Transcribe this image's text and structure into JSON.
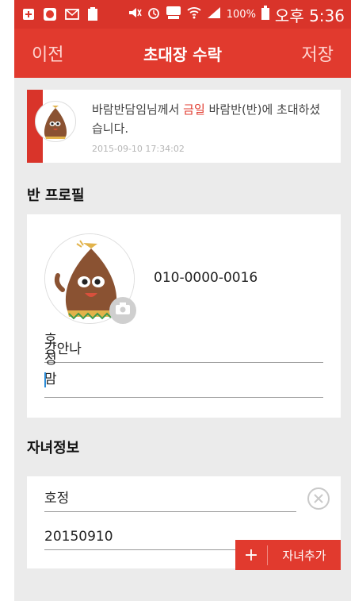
{
  "status_bar": {
    "battery": "100%",
    "time": "오후 5:36"
  },
  "appbar": {
    "back_label": "이전",
    "title": "초대장 수락",
    "save_label": "저장"
  },
  "invite": {
    "message_prefix": "바람반담임님께서 ",
    "highlight": "금일",
    "message_suffix": " 바람반(반)에 초대하셨습니다.",
    "timestamp": "2015-09-10 17:34:02"
  },
  "profile_section": {
    "title": "반 프로필",
    "phone": "010-0000-0016",
    "name_value": "강안나",
    "nickname_value": "호정맘"
  },
  "children_section": {
    "title": "자녀정보",
    "child_name_value": "호정",
    "child_birth_value": "20150910",
    "add_child_label": "자녀추가"
  },
  "colors": {
    "accent": "#e13a2e",
    "status_bar": "#d9342a"
  }
}
